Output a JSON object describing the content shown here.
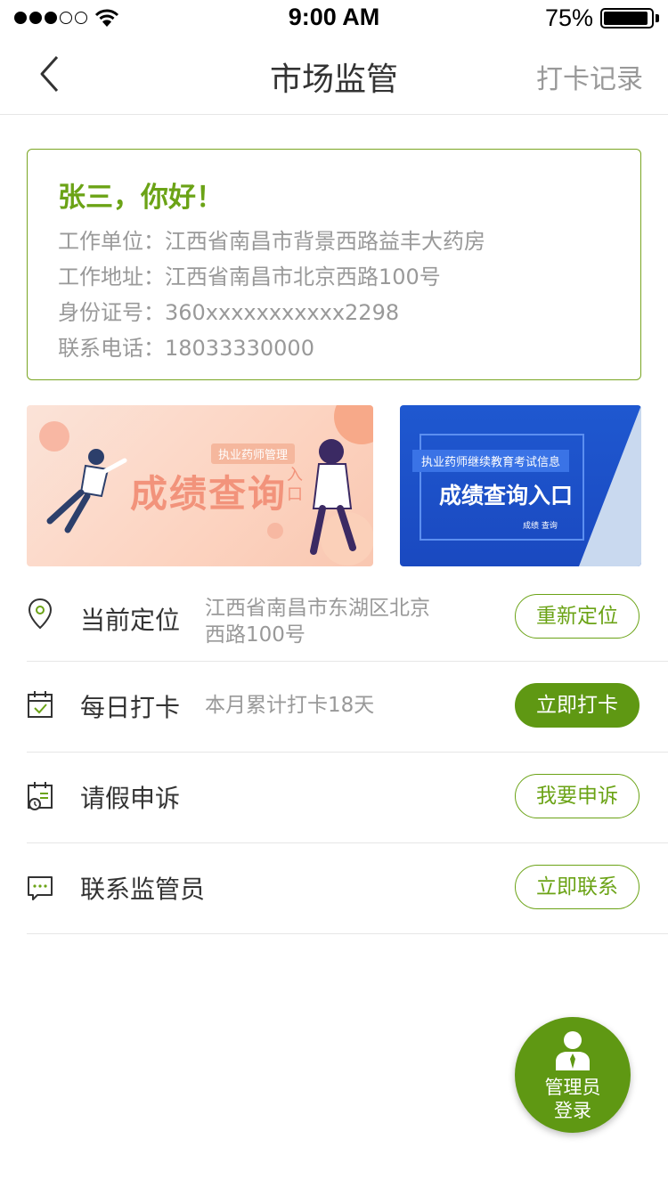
{
  "status_bar": {
    "time": "9:00 AM",
    "battery_percent": "75%",
    "battery_level": 0.95,
    "signal_bars": 3
  },
  "nav": {
    "title": "市场监管",
    "right_link": "打卡记录",
    "back_icon": "chevron-left-icon"
  },
  "info_card": {
    "greeting": "张三，你好！",
    "rows": [
      "工作单位：江西省南昌市背景西路益丰大药房",
      "工作地址：江西省南昌市北京西路100号",
      "身份证号：360xxxxxxxxxxx2298",
      "联系电话：18033330000"
    ]
  },
  "banners": [
    {
      "tag": "执业药师管理",
      "title": "成绩查询",
      "sub": "入口"
    },
    {
      "tag": "执业药师继续教育考试信息",
      "title": "成绩查询入口",
      "foot": "成绩 查询"
    }
  ],
  "actions": [
    {
      "label": "当前定位",
      "desc": "江西省南昌市东湖区北京\n西路100号",
      "button": "重新定位",
      "icon": "location-pin-icon"
    },
    {
      "label": "每日打卡",
      "desc": "本月累计打卡18天",
      "button": "立即打卡",
      "icon": "calendar-check-icon"
    },
    {
      "label": "请假申诉",
      "desc": "",
      "button": "我要申诉",
      "icon": "calendar-clock-icon"
    },
    {
      "label": "联系监管员",
      "desc": "",
      "button": "立即联系",
      "icon": "chat-bubble-icon"
    }
  ],
  "fab": {
    "line1": "管理员",
    "line2": "登录",
    "icon": "admin-user-icon"
  },
  "colors": {
    "accent": "#5f9813",
    "accent_text": "#6ba316",
    "border": "#e6e6e6"
  }
}
